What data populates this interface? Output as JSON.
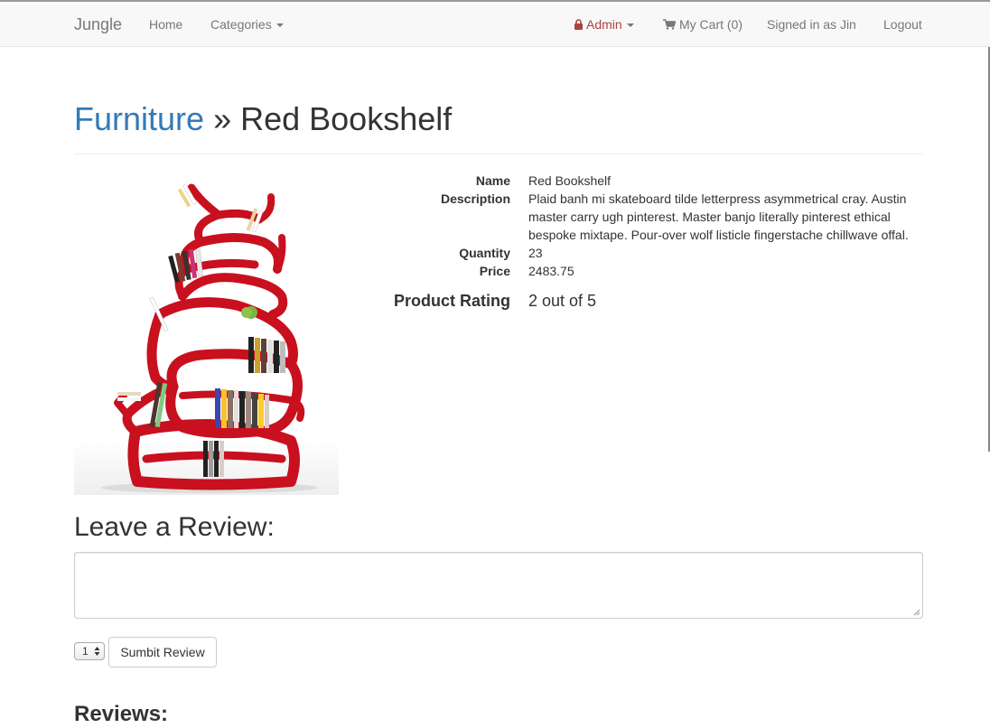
{
  "nav": {
    "brand": "Jungle",
    "home": "Home",
    "categories": "Categories",
    "admin": "Admin",
    "cart": "My Cart (0)",
    "signed_in": "Signed in as Jin",
    "logout": "Logout"
  },
  "page": {
    "category": "Furniture",
    "separator": " » ",
    "product_title": "Red Bookshelf"
  },
  "product": {
    "name_label": "Name",
    "name": "Red Bookshelf",
    "description_label": "Description",
    "description": "Plaid banh mi skateboard tilde letterpress asymmetrical cray. Austin master carry ugh pinterest. Master banjo literally pinterest ethical bespoke mixtape. Pour-over wolf listicle fingerstache chillwave offal.",
    "quantity_label": "Quantity",
    "quantity": "23",
    "price_label": "Price",
    "price": "2483.75",
    "rating_label": "Product Rating",
    "rating": "2 out of 5"
  },
  "review_form": {
    "title": "Leave a Review:",
    "textarea_value": "",
    "rating_selected": "1",
    "submit_label": "Sumbit Review"
  },
  "reviews": {
    "title": "Reviews:"
  },
  "colors": {
    "link": "#337ab7",
    "admin": "#a94442",
    "shelf_red": "#c8101e"
  },
  "icons": {
    "lock": "lock-icon",
    "cart": "shopping-cart-icon"
  }
}
